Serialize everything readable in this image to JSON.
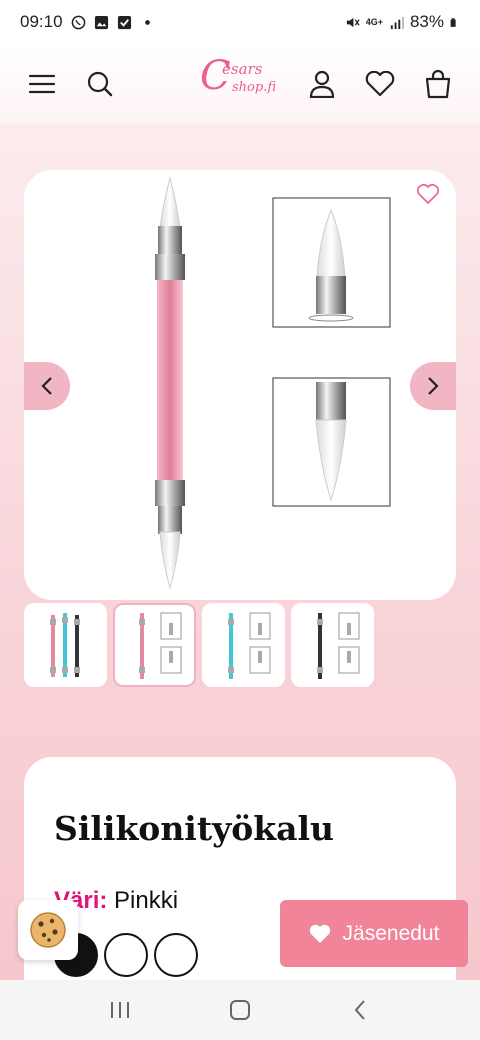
{
  "status_bar": {
    "time": "09:10",
    "battery": "83%",
    "network": "4G+",
    "left_icons": [
      "whatsapp-icon",
      "gallery-icon",
      "checkbox-icon",
      "dot-icon"
    ],
    "right_icons": [
      "mute-icon",
      "network-icon",
      "signal-icon",
      "battery-icon"
    ]
  },
  "header": {
    "logo_main": "C",
    "logo_line1": "esars",
    "logo_line2": "shop.fi",
    "icons": [
      "menu-icon",
      "search-icon",
      "account-icon",
      "wishlist-icon",
      "cart-icon"
    ]
  },
  "gallery": {
    "selected_index": 1,
    "thumbnails": [
      "Pinkki, Turkoosi, Musta",
      "Pinkki",
      "Turkoosi",
      "Musta"
    ]
  },
  "product": {
    "title": "Silikonityökalu",
    "color_label": "Väri:",
    "color_value": "Pinkki",
    "swatches": [
      "black",
      "white",
      "white"
    ]
  },
  "members_button": {
    "label": "Jäsenedut"
  },
  "colors": {
    "brand_pink": "#ec5f8a",
    "button_pink": "#f2849a",
    "label_magenta": "#e3127a",
    "arrow_bg": "#f1b5c3"
  }
}
